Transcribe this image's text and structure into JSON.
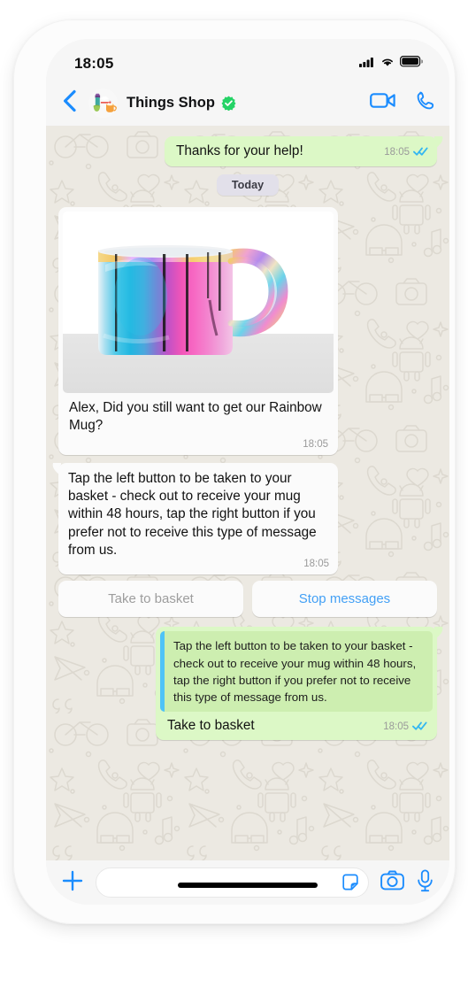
{
  "status_bar": {
    "time": "18:05",
    "cellular_icon": "signal-bars-icon",
    "wifi_icon": "wifi-icon",
    "battery_icon": "battery-full-icon"
  },
  "header": {
    "back_icon": "chevron-left-icon",
    "avatar_icon": "shop-mugs-avatar",
    "contact_name": "Things Shop",
    "verified_icon": "verified-badge-icon",
    "video_call_icon": "video-camera-icon",
    "voice_call_icon": "phone-icon"
  },
  "chat": {
    "date_divider": "Today",
    "messages": [
      {
        "id": "thanks",
        "direction": "outgoing",
        "text": "Thanks for your help!",
        "time": "18:05",
        "status_icon": "double-check-icon"
      },
      {
        "id": "product",
        "direction": "incoming",
        "image_alt": "rainbow-iridescent-mug-photo",
        "caption": "Alex, Did you still want to get our Rainbow Mug?",
        "time": "18:05"
      },
      {
        "id": "instructions",
        "direction": "incoming",
        "text": "Tap the left button to be taken to your basket - check out to receive your mug within 48 hours, tap the right button if you prefer not to receive this type of message from us.",
        "time": "18:05"
      },
      {
        "id": "reply",
        "direction": "outgoing",
        "quoted_text": "Tap the left button to be taken to your basket - check out to receive your mug within 48 hours, tap the right button if you prefer not to receive this type of message from us.",
        "text": "Take to basket",
        "time": "18:05",
        "status_icon": "double-check-icon"
      }
    ],
    "action_buttons": [
      {
        "label": "Take to basket",
        "state": "disabled"
      },
      {
        "label": "Stop messages",
        "state": "primary"
      }
    ]
  },
  "input_bar": {
    "attach_icon": "plus-icon",
    "message_value": "",
    "message_placeholder": "",
    "sticker_icon": "sticker-icon",
    "camera_icon": "camera-icon",
    "mic_icon": "microphone-icon"
  },
  "colors": {
    "accent_blue": "#1b8cfe",
    "outgoing_bubble": "#dcf8c6",
    "incoming_bubble": "#fbfbfb",
    "quote_bar": "#4fc3f7",
    "verified_green": "#25d366",
    "chat_background": "#ece9e2",
    "check_blue": "#34b7f1",
    "date_pill": "#e2e0ea"
  }
}
